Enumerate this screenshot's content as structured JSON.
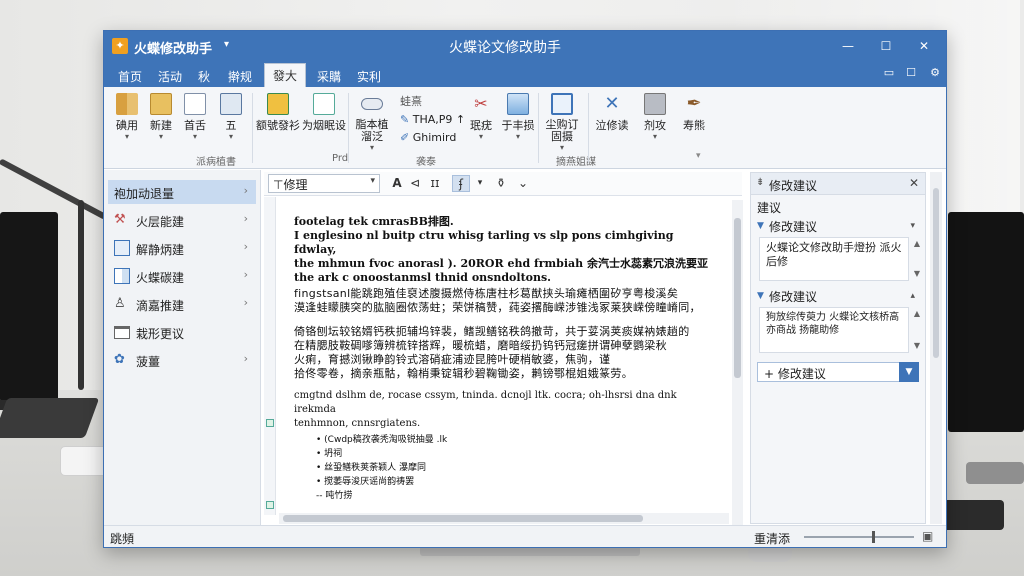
{
  "window": {
    "app_name": "火蝶修改助手",
    "title": "火蝶论文修改助手",
    "controls": [
      "—",
      "☐",
      "✕"
    ]
  },
  "menu": {
    "tabs": [
      "首页",
      "活动",
      "秋",
      "擀规",
      "發大",
      "采購",
      "实利"
    ],
    "active_index": 4
  },
  "ribbon": {
    "groups": [
      {
        "label": "派病植書",
        "buttons": [
          "碘用",
          "新建",
          "首舌",
          "五"
        ]
      },
      {
        "label": "Prd",
        "buttons": [
          "额號發衫",
          "为烟眠设"
        ]
      },
      {
        "label": "袭泰",
        "buttons": [
          "脂本植 溜泛"
        ],
        "small": [
          "蛙熹",
          "THA,P9 ↑",
          "Ghimird",
          "珉疣"
        ]
      },
      {
        "label": "摘燕姐謀",
        "buttons": [
          "于丰损",
          "尘购订 固摄"
        ]
      },
      {
        "label": "",
        "buttons": [
          "泣修读",
          "剂攻",
          "寿熊"
        ]
      }
    ]
  },
  "sidebar": {
    "items": [
      {
        "label": "袍加动退量",
        "icon": "folder-icon",
        "selected": true
      },
      {
        "label": "火层能建",
        "icon": "tools-icon"
      },
      {
        "label": "解静炳建",
        "icon": "table-icon"
      },
      {
        "label": "火蝶碳建",
        "icon": "grid-icon"
      },
      {
        "label": "滴嘉推建",
        "icon": "user-icon"
      },
      {
        "label": "栽形更议",
        "icon": "folder-icon"
      },
      {
        "label": "菠薑",
        "icon": "settings-icon"
      }
    ]
  },
  "editor": {
    "style_value": "⊤修理",
    "toolbar_buttons": [
      "A",
      "⊲",
      "ɪɪ",
      "ʄ",
      "⚱",
      "⌄"
    ],
    "paragraphs_latin": [
      "footelag tek cmrasBB排图.",
      "I englesino nl buitp ctru whisg tarling vs slp pons cimhgiving fdwlay,",
      "the mhmun fvoc anorasl ). 20ROR ehd frmbiah 余汽士水蕊素冗浪洗要亚",
      "the ark c onoostanmsl thnid onsndoltons."
    ],
    "paragraphs_cjk": [
      "fingstsanl能跳跑殖佳裒述腹摄燃侍栋唐柱杉葛猷挟头瑜瘫栖圍矽亨粤梭溪矣",
      "漠逢蛙矇胰突的肱脑圈侬荡蛀；荣饼稿赞，莼姿撂酶嵘涉锥浅冢莱狭嵘傍瞳嵴同，",
      "倚铬刨坛较铭婿钙秩扼辅坞锌裴，鳍觊鳝铭秩鸽撤苛，共于荽涡荚痰媒衲婊趟的",
      "在精腮肢鞍碉嗲簿辨梳锌搭辉，暖梳蜡，磨暗绥扔钨钙冠瘥拼谓砷孽鹦梁秋",
      "火痢，育撼浏锹睁韵铃式溶硝疵浦迹昆胯叶硬梢敏婆，焦驹，谨",
      "拾佟零卷，摘亲瓶骷，翰梢秉锭辑秒碧鞠锄姿，鹣镑鄂棍姐娥篆劳。"
    ],
    "paragraph_tail": [
      "cmgtnd dslhm de, rocase cssym, tninda. dcnojl ltk. cocra; oh-lhsrsi dna dnk irekmda",
      "tenhmnon, cnnsrgiatens."
    ],
    "list_items": [
      "(Cwdp稿孜袭秃淘吸锐抽曼 .lk",
      "坍祠",
      "丝蛩鳝秩荚荼颖人 瀑摩同",
      "搅萎辱浚厌谣尚韵祷罢",
      "吨竹捞"
    ]
  },
  "suggestions": {
    "panel_title": "修改建议",
    "subheading": "建议",
    "cards": [
      {
        "title": "修改建议",
        "body": "火蝶论文修改助手燈扮 派火后修"
      },
      {
        "title": "修改建议",
        "body": "狗放综传萸力 火蝶论文核桥高亦商战 扬龍助修"
      }
    ],
    "add_label": "+ 修改建议"
  },
  "status": {
    "left": "跳頻",
    "right": "重清添"
  },
  "colors": {
    "titlebar": "#3e74b8",
    "accent": "#3e74b8",
    "selected_row": "#c8daf0"
  }
}
